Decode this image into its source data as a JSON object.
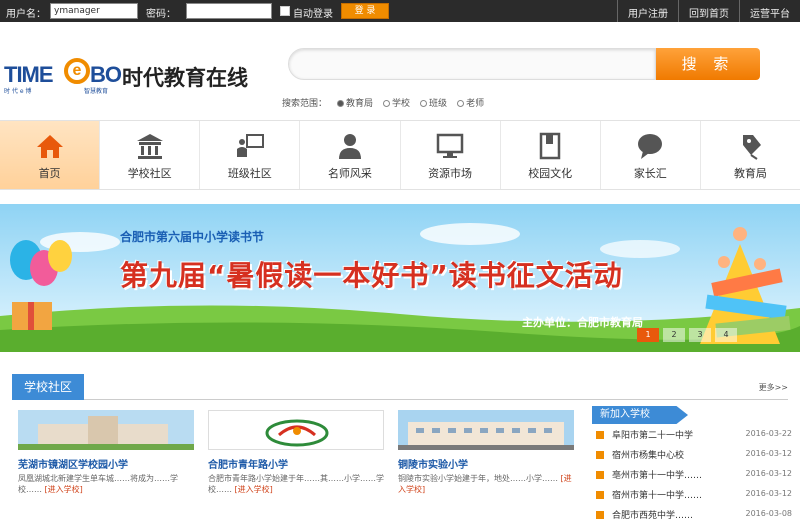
{
  "topbar": {
    "username_label": "用户名：",
    "username_value": "ymanager",
    "password_label": "密码：",
    "auto_login": "自动登录",
    "login_button": "登 录",
    "links": [
      "用户注册",
      "回到首页",
      "运营平台"
    ]
  },
  "logo": {
    "time": "TIME",
    "e": "e",
    "bo": "BO",
    "name": "时代教育在线",
    "sub1": "时 代 e 博",
    "sub2": "智慧教育"
  },
  "search": {
    "button": "搜 索",
    "options_label": "搜索范围：",
    "options": [
      "教育局",
      "学校",
      "班级",
      "老师"
    ],
    "selected": 0
  },
  "nav": {
    "items": [
      "首页",
      "学校社区",
      "班级社区",
      "名师风采",
      "资源市场",
      "校园文化",
      "家长汇",
      "教育局"
    ],
    "icons": [
      "home-icon",
      "school-icon",
      "class-icon",
      "teacher-icon",
      "monitor-icon",
      "book-icon",
      "chat-icon",
      "pin-icon"
    ],
    "active": 0
  },
  "banner": {
    "subtitle": "合肥市第六届中小学读书节",
    "title": "第九届“暑假读一本好书”读书征文活动",
    "organizer": "主办单位：合肥市教育局",
    "pages": [
      "1",
      "2",
      "3",
      "4"
    ],
    "current_page": 0
  },
  "section": {
    "tab": "学校社区",
    "more": "更多>>"
  },
  "cards": [
    {
      "name": "芜湖市镜湖区学校园小学",
      "desc": "凤凰湖城北新建学生单车城……将成为……学校……",
      "enter": "[进入学校]"
    },
    {
      "name": "合肥市青年路小学",
      "desc": "合肥市青年路小学始建于年……其……小学……学校……",
      "enter": "[进入学校]"
    },
    {
      "name": "铜陵市实验小学",
      "desc": "铜陵市实验小学始建于年，地处……小学……",
      "enter": "[进入学校]"
    }
  ],
  "news": {
    "header": "新加入学校",
    "items": [
      {
        "title": "阜阳市第二十一中学",
        "date": "2016-03-22"
      },
      {
        "title": "宿州市杨集中心校",
        "date": "2016-03-12"
      },
      {
        "title": "亳州市第十一中学……",
        "date": "2016-03-12"
      },
      {
        "title": "宿州市第十一中学……",
        "date": "2016-03-12"
      },
      {
        "title": "合肥市西苑中学……",
        "date": "2016-03-08"
      }
    ]
  },
  "colors": {
    "accent_orange": "#f08c00",
    "accent_blue": "#3d8bd6",
    "topbar_bg": "#2b2b2b"
  }
}
